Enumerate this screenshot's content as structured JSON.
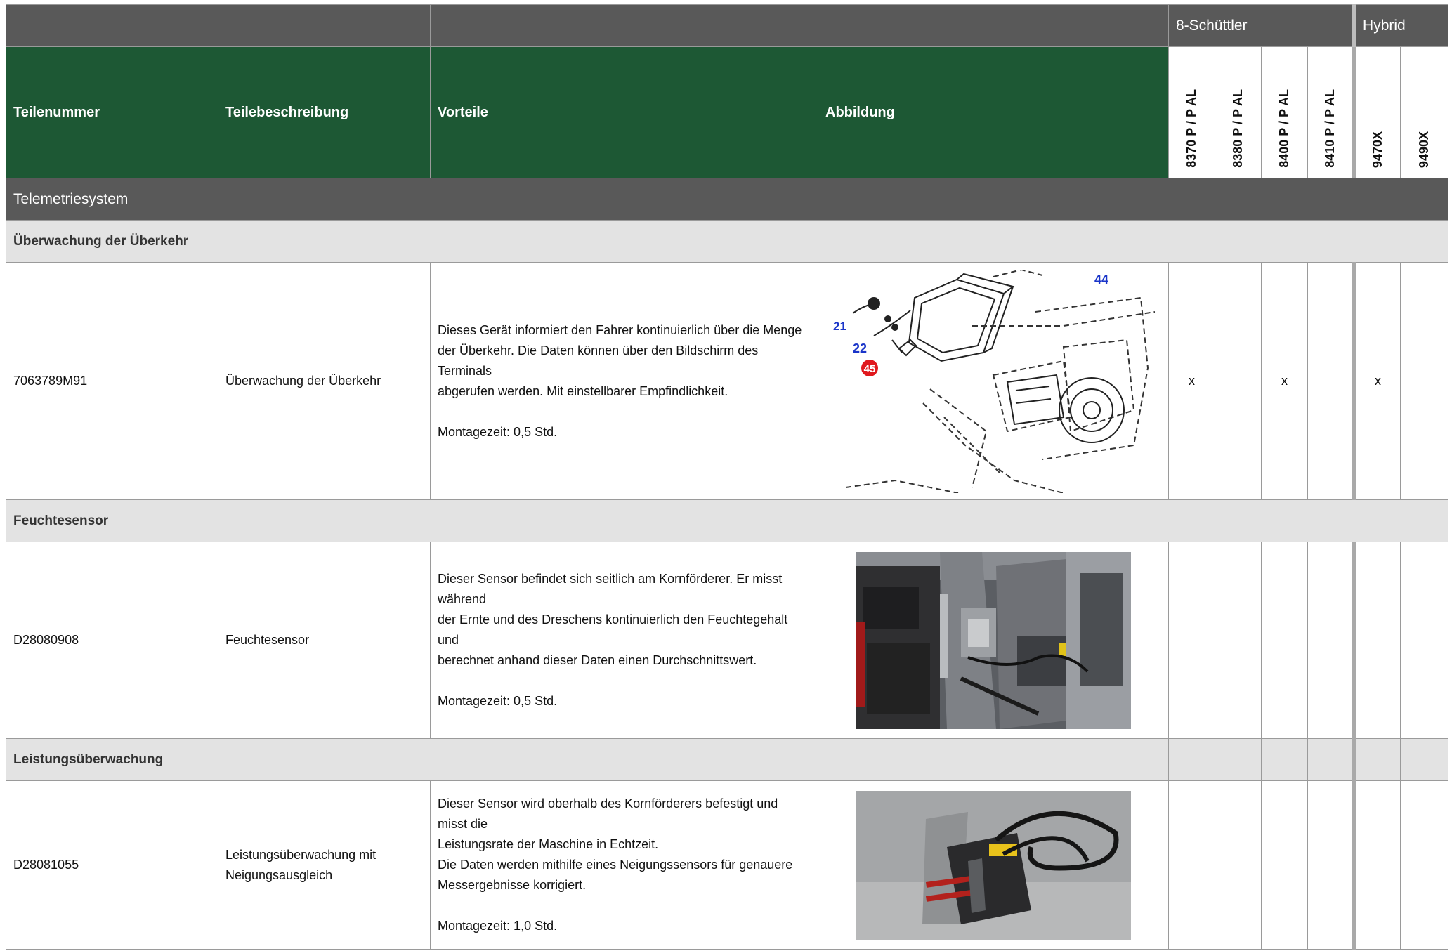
{
  "header": {
    "group_8_schuettler": "8-Schüttler",
    "group_hybrid": "Hybrid",
    "col_part_number": "Teilenummer",
    "col_part_description": "Teilebeschreibung",
    "col_benefits": "Vorteile",
    "col_illustration": "Abbildung",
    "models": [
      "8370 P / P AL",
      "8380 P / P AL",
      "8400 P / P AL",
      "8410 P / P AL",
      "9470X",
      "9490X"
    ]
  },
  "section": {
    "title": "Telemetriesystem"
  },
  "groups": [
    {
      "title": "Überwachung der Überkehr",
      "item": {
        "part_number": "7063789M91",
        "description": "Überwachung der Überkehr",
        "benefit_lines": [
          "Dieses Gerät informiert den Fahrer kontinuierlich über die Menge",
          "der Überkehr. Die Daten können über den Bildschirm des Terminals",
          "abgerufen werden. Mit einstellbarer Empfindlichkeit."
        ],
        "mounting": "Montagezeit: 0,5 Std.",
        "image_labels": [
          "44",
          "21",
          "22",
          "45"
        ],
        "marks": [
          "x",
          "",
          "x",
          "",
          "x",
          ""
        ]
      }
    },
    {
      "title": "Feuchtesensor",
      "item": {
        "part_number": "D28080908",
        "description": "Feuchtesensor",
        "benefit_lines": [
          "Dieser Sensor befindet sich seitlich am Kornförderer. Er misst während",
          "der Ernte und des Dreschens kontinuierlich den Feuchtegehalt und",
          "berechnet anhand dieser Daten einen Durchschnittswert."
        ],
        "mounting": "Montagezeit: 0,5 Std.",
        "marks": [
          "",
          "",
          "",
          "",
          "",
          ""
        ]
      }
    },
    {
      "title": "Leistungsüberwachung",
      "item": {
        "part_number": "D28081055",
        "description_lines": [
          "Leistungsüberwachung mit",
          "Neigungsausgleich"
        ],
        "benefit_lines": [
          "Dieser Sensor wird oberhalb des Kornförderers befestigt und misst die",
          "Leistungsrate der Maschine in Echtzeit.",
          "Die Daten werden mithilfe eines Neigungssensors für genauere",
          "Messergebnisse korrigiert."
        ],
        "mounting": "Montagezeit: 1,0 Std.",
        "marks": [
          "",
          "",
          "",
          "",
          "",
          ""
        ]
      }
    }
  ]
}
